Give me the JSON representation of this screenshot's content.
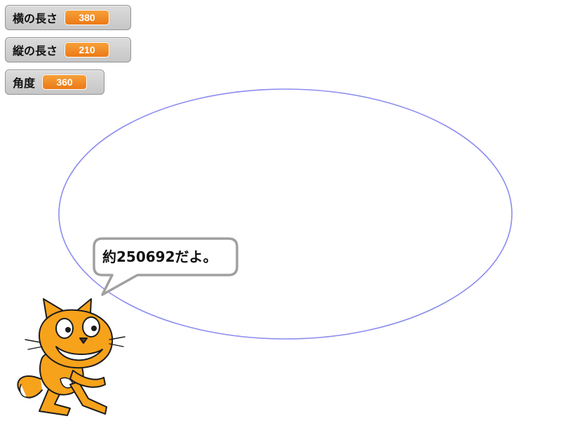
{
  "monitors": [
    {
      "label": "横の長さ",
      "value": "380"
    },
    {
      "label": "縦の長さ",
      "value": "210"
    },
    {
      "label": "角度",
      "value": "360"
    }
  ],
  "speech_bubble": {
    "text": "約250692だよ。"
  },
  "colors": {
    "ellipse_stroke": "#8c8cf0",
    "monitor_value_bg": "#ee7d16",
    "cat_orange": "#f7a21b",
    "bubble_border": "#a0a0a0"
  },
  "sprite": {
    "icon": "scratch-cat-icon"
  }
}
